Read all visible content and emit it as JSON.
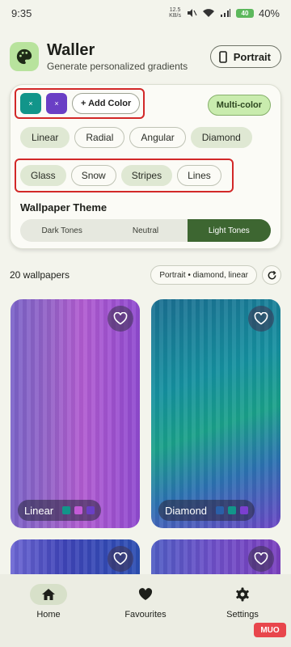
{
  "status_bar": {
    "time": "9:35",
    "net_speed_top": "12.5",
    "net_speed_bottom": "KB/s",
    "battery_level": "40",
    "battery_pct": "40%"
  },
  "app": {
    "title": "Waller",
    "subtitle": "Generate personalized gradients",
    "orientation_label": "Portrait"
  },
  "colors": {
    "chips": [
      {
        "color": "#12958a",
        "remove_label": "×"
      },
      {
        "color": "#6a3fc5",
        "remove_label": "×"
      }
    ],
    "add_label": "+ Add Color",
    "mode_label": "Multi-color"
  },
  "gradient_types": [
    "Linear",
    "Radial",
    "Angular",
    "Diamond"
  ],
  "effects": [
    "Glass",
    "Snow",
    "Stripes",
    "Lines"
  ],
  "theme": {
    "label": "Wallpaper Theme",
    "options": [
      "Dark Tones",
      "Neutral",
      "Light Tones"
    ],
    "selected": "Light Tones"
  },
  "results": {
    "count_text": "20 wallpapers",
    "filter_text": "Portrait • diamond, linear"
  },
  "wallpapers": [
    {
      "label": "Linear",
      "colors": [
        "#12958a",
        "#c25bd6",
        "#6a3fc5"
      ]
    },
    {
      "label": "Diamond",
      "colors": [
        "#2a5fa8",
        "#12958a",
        "#7b3fd0"
      ]
    }
  ],
  "nav": [
    {
      "label": "Home",
      "icon": "home-icon",
      "active": true
    },
    {
      "label": "Favourites",
      "icon": "heart-icon",
      "active": false
    },
    {
      "label": "Settings",
      "icon": "gear-icon",
      "active": false
    }
  ],
  "watermark": "MUO",
  "accent": "#3d6631"
}
